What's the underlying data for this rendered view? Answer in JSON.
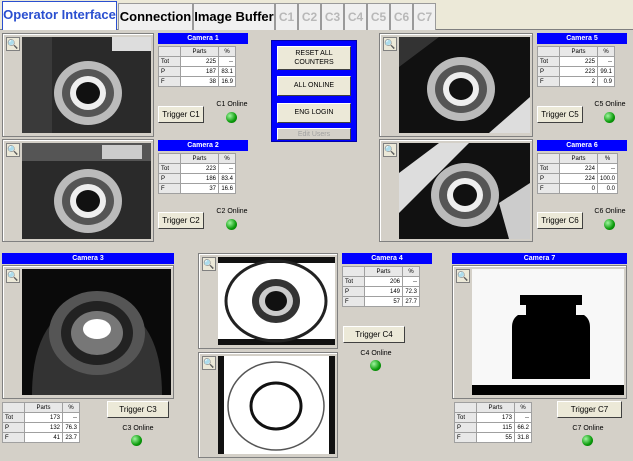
{
  "tabs": [
    {
      "label": "Operator Interface"
    },
    {
      "label": "Connection"
    },
    {
      "label": "Image Buffer"
    },
    {
      "label": "C1"
    },
    {
      "label": "C2"
    },
    {
      "label": "C3"
    },
    {
      "label": "C4"
    },
    {
      "label": "C5"
    },
    {
      "label": "C6"
    },
    {
      "label": "C7"
    }
  ],
  "table_headers": {
    "parts": "Parts",
    "pct": "%",
    "tot": "Tot",
    "p": "P",
    "f": "F"
  },
  "cameras": {
    "c1": {
      "title": "Camera 1",
      "tot": "225",
      "tot_pct": "--",
      "p": "187",
      "p_pct": "83.1",
      "f": "38",
      "f_pct": "16.9",
      "trigger": "Trigger C1",
      "status": "C1 Online"
    },
    "c2": {
      "title": "Camera 2",
      "tot": "223",
      "tot_pct": "--",
      "p": "186",
      "p_pct": "83.4",
      "f": "37",
      "f_pct": "16.6",
      "trigger": "Trigger C2",
      "status": "C2 Online"
    },
    "c3": {
      "title": "Camera 3",
      "tot": "173",
      "tot_pct": "--",
      "p": "132",
      "p_pct": "76.3",
      "f": "41",
      "f_pct": "23.7",
      "trigger": "Trigger C3",
      "status": "C3 Online"
    },
    "c4": {
      "title": "Camera 4",
      "tot": "206",
      "tot_pct": "--",
      "p": "149",
      "p_pct": "72.3",
      "f": "57",
      "f_pct": "27.7",
      "trigger": "Trigger C4",
      "status": "C4 Online"
    },
    "c5": {
      "title": "Camera 5",
      "tot": "225",
      "tot_pct": "--",
      "p": "223",
      "p_pct": "99.1",
      "f": "2",
      "f_pct": "0.9",
      "trigger": "Trigger C5",
      "status": "C5 Online"
    },
    "c6": {
      "title": "Camera 6",
      "tot": "224",
      "tot_pct": "--",
      "p": "224",
      "p_pct": "100.0",
      "f": "0",
      "f_pct": "0.0",
      "trigger": "Trigger C6",
      "status": "C6 Online"
    },
    "c7": {
      "title": "Camera 7",
      "tot": "173",
      "tot_pct": "--",
      "p": "115",
      "p_pct": "66.2",
      "f": "55",
      "f_pct": "31.8",
      "trigger": "Trigger C7",
      "status": "C7 Online"
    }
  },
  "control": {
    "reset_all_counters": "RESET ALL COUNTERS",
    "all_online": "ALL ONLINE",
    "eng_login": "ENG LOGIN",
    "edit_users": "Edit Users"
  },
  "colors": {
    "accent": "#0000ff",
    "online_led": "#0a9a0a",
    "active_tab": "#2a4fd0"
  },
  "icons": {
    "zoom": "magnifier-icon",
    "online": "status-led-icon"
  }
}
